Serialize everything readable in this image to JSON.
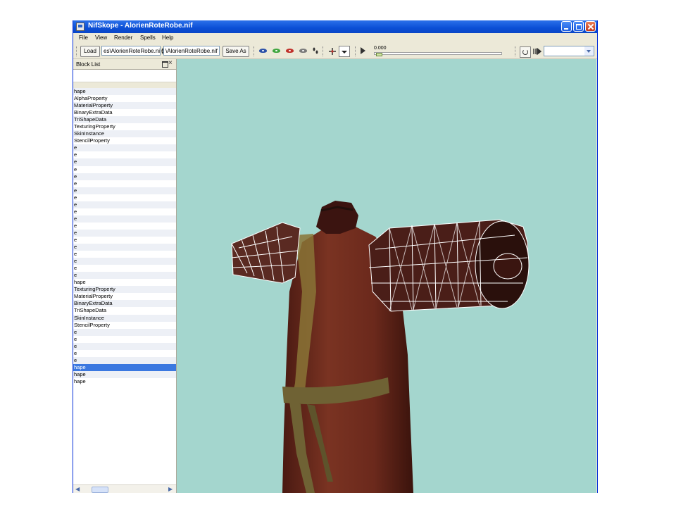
{
  "window": {
    "title": "NifSkope - AlorienRoteRobe.nif"
  },
  "menu": {
    "items": [
      "File",
      "View",
      "Render",
      "Spells",
      "Help"
    ]
  },
  "toolbar": {
    "load_label": "Load",
    "load_path": "es\\AlorienRoteRobe.nif",
    "save_path": "\\AlorienRoteRobe.nif",
    "save_as_label": "Save As",
    "anim_time": "0.000",
    "anim_select_value": ""
  },
  "block_list": {
    "title": "Block List",
    "rows": [
      "hape",
      "AlphaProperty",
      "MaterialProperty",
      "BinaryExtraData",
      "TriShapeData",
      "TexturingProperty",
      "SkinInstance",
      "StencilProperty",
      "e",
      "e",
      "e",
      "e",
      "e",
      "e",
      "e",
      "e",
      "e",
      "e",
      "e",
      "e",
      "e",
      "e",
      "e",
      "e",
      "e",
      "e",
      "e",
      "hape",
      "TexturingProperty",
      "MaterialProperty",
      "BinaryExtraData",
      "TriShapeData",
      "SkinInstance",
      "StencilProperty",
      "e",
      "e",
      "e",
      "e",
      "e",
      "hape",
      "hape",
      "hape"
    ],
    "selected_index": 39
  },
  "viewport": {
    "background_color": "#a4d6ce",
    "robe_color": "#6e2a1e",
    "trim_color": "#8a7436",
    "wireframe_color": "#ffffff"
  },
  "icons": {
    "window": [
      "app-icon",
      "minimize-icon",
      "maximize-icon",
      "close-icon"
    ],
    "toolbar": [
      "eye-icon",
      "eye-icon",
      "eye-icon",
      "eye-icon",
      "footprints-icon",
      "axes-icon",
      "chevron-down-icon",
      "play-icon",
      "loop-icon",
      "switch-icon",
      "chevron-down-icon"
    ],
    "panel": [
      "float-icon",
      "close-icon",
      "chevron-left-icon",
      "chevron-right-icon"
    ]
  }
}
